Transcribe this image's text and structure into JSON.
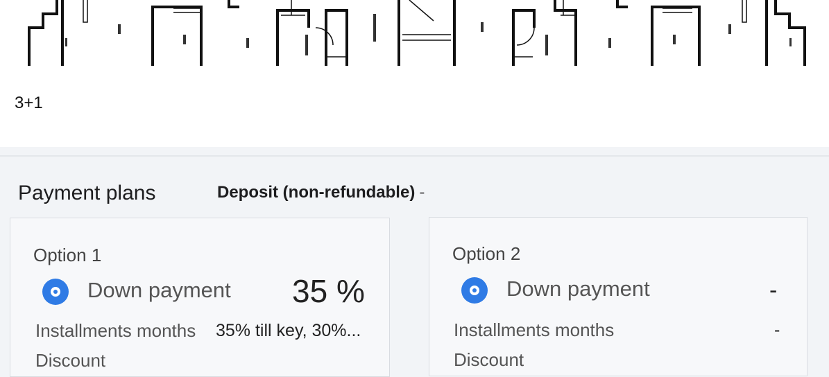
{
  "unit": {
    "type": "3+1"
  },
  "payment": {
    "title": "Payment plans",
    "deposit_label": "Deposit (non-refundable)",
    "deposit_value": "-"
  },
  "options": [
    {
      "title": "Option 1",
      "down_payment_label": "Down payment",
      "down_payment_value": "35 %",
      "installments_label": "Installments months",
      "installments_value": "35% till key, 30%...",
      "discount_label": "Discount"
    },
    {
      "title": "Option 2",
      "down_payment_label": "Down payment",
      "down_payment_value": "-",
      "installments_label": "Installments months",
      "installments_value": "-",
      "discount_label": "Discount"
    }
  ],
  "colors": {
    "accent": "#2f7be5"
  },
  "icons": {
    "selected_radio": "radio-selected-icon"
  }
}
